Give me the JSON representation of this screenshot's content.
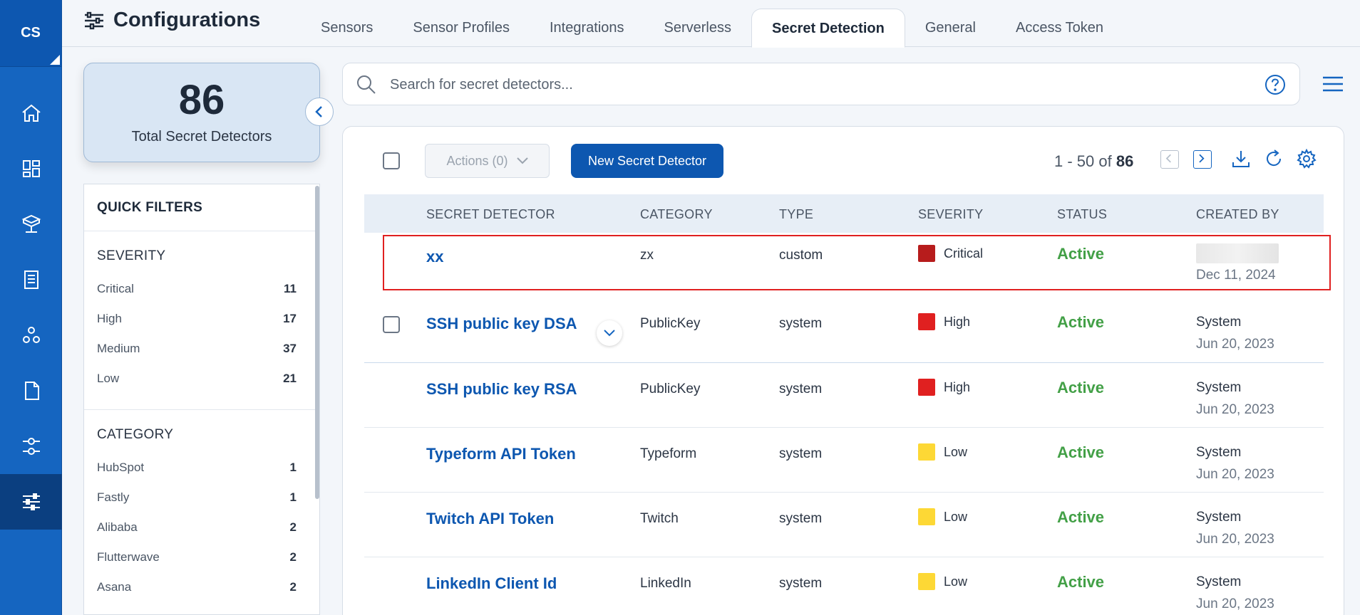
{
  "app": {
    "initials": "CS"
  },
  "header": {
    "title": "Configurations",
    "tabs": [
      {
        "label": "Sensors",
        "active": false
      },
      {
        "label": "Sensor Profiles",
        "active": false
      },
      {
        "label": "Integrations",
        "active": false
      },
      {
        "label": "Serverless",
        "active": false
      },
      {
        "label": "Secret Detection",
        "active": true
      },
      {
        "label": "General",
        "active": false
      },
      {
        "label": "Access Token",
        "active": false
      }
    ]
  },
  "summary": {
    "count": "86",
    "label": "Total Secret Detectors"
  },
  "quick_filters": {
    "title": "QUICK FILTERS",
    "severity": {
      "title": "SEVERITY",
      "items": [
        {
          "label": "Critical",
          "count": "11"
        },
        {
          "label": "High",
          "count": "17"
        },
        {
          "label": "Medium",
          "count": "37"
        },
        {
          "label": "Low",
          "count": "21"
        }
      ]
    },
    "category": {
      "title": "CATEGORY",
      "items": [
        {
          "label": "HubSpot",
          "count": "1"
        },
        {
          "label": "Fastly",
          "count": "1"
        },
        {
          "label": "Alibaba",
          "count": "2"
        },
        {
          "label": "Flutterwave",
          "count": "2"
        },
        {
          "label": "Asana",
          "count": "2"
        }
      ]
    }
  },
  "search": {
    "placeholder": "Search for secret detectors...",
    "value": ""
  },
  "toolbar": {
    "actions_label": "Actions (0)",
    "new_label": "New Secret Detector",
    "paging_range": "1 - 50 of",
    "paging_total": "86"
  },
  "table": {
    "columns": [
      "SECRET DETECTOR",
      "CATEGORY",
      "TYPE",
      "SEVERITY",
      "STATUS",
      "CREATED BY"
    ],
    "rows": [
      {
        "name": "xx",
        "category": "zx",
        "type": "custom",
        "severity": "Critical",
        "severity_color": "#b71c1c",
        "status": "Active",
        "created_by": "",
        "created_date": "Dec 11, 2024"
      },
      {
        "name": "SSH public key DSA",
        "category": "PublicKey",
        "type": "system",
        "severity": "High",
        "severity_color": "#e02020",
        "status": "Active",
        "created_by": "System",
        "created_date": "Jun 20, 2023"
      },
      {
        "name": "SSH public key RSA",
        "category": "PublicKey",
        "type": "system",
        "severity": "High",
        "severity_color": "#e02020",
        "status": "Active",
        "created_by": "System",
        "created_date": "Jun 20, 2023"
      },
      {
        "name": "Typeform API Token",
        "category": "Typeform",
        "type": "system",
        "severity": "Low",
        "severity_color": "#fdd835",
        "status": "Active",
        "created_by": "System",
        "created_date": "Jun 20, 2023"
      },
      {
        "name": "Twitch API Token",
        "category": "Twitch",
        "type": "system",
        "severity": "Low",
        "severity_color": "#fdd835",
        "status": "Active",
        "created_by": "System",
        "created_date": "Jun 20, 2023"
      },
      {
        "name": "LinkedIn Client Id",
        "category": "LinkedIn",
        "type": "system",
        "severity": "Low",
        "severity_color": "#fdd835",
        "status": "Active",
        "created_by": "System",
        "created_date": "Jun 20, 2023"
      }
    ]
  },
  "colors": {
    "brand": "#1565c0",
    "status_active": "#43a047",
    "highlight": "#e02020"
  }
}
